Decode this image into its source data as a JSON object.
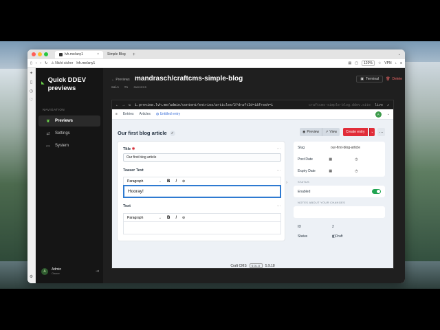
{
  "browser": {
    "tabs": [
      {
        "label": "lvh.me/any1",
        "active": true
      },
      {
        "label": "Simple Blog",
        "active": false
      }
    ],
    "url": {
      "security": "Nicht sicher",
      "address": "lvh.me/any1",
      "zoom": "120%",
      "vpn": "VPN"
    }
  },
  "ddev": {
    "app_name": "Quick DDEV previews",
    "nav_heading": "NAVIGATION",
    "nav": [
      {
        "label": "Previews",
        "icon": "leaf-icon",
        "active": true
      },
      {
        "label": "Settings",
        "icon": "sliders-icon",
        "active": false
      },
      {
        "label": "System",
        "icon": "server-icon",
        "active": false
      }
    ],
    "user": {
      "initial": "A",
      "name": "Admin",
      "role": "Owner"
    },
    "breadcrumb": "Previews",
    "project_title": "mandrasch/craftcms-simple-blog",
    "branch": "main",
    "pr": "#1",
    "status": "success",
    "terminal_label": "Terminal",
    "delete_label": "Delete"
  },
  "preview": {
    "url": "1.preview.lvh.me/admin/content/entries/articles/2?draftId=1&fresh=1",
    "host": "craftcms-simple-blog.ddev.site",
    "live": "live",
    "craft": {
      "crumbs": [
        "Entries",
        "Articles",
        "Untitled entry"
      ],
      "avatar": "A",
      "entry_title": "Our first blog article",
      "preview_label": "Preview",
      "view_label": "View",
      "create_label": "Create entry",
      "fields": {
        "title_label": "Title",
        "title_value": "Our first blog article",
        "teaser_label": "Teaser Text",
        "teaser_value": "Hooray!",
        "text_label": "Text",
        "paragraph": "Paragraph"
      },
      "meta": {
        "slug_label": "Slug",
        "slug_value": "our-first-blog-article",
        "post_date_label": "Post Date",
        "expiry_date_label": "Expiry Date",
        "status_heading": "STATUS",
        "enabled_label": "Enabled",
        "enabled": true,
        "notes_heading": "NOTES ABOUT YOUR CHANGES",
        "id_label": "ID",
        "id_value": "2",
        "status_label": "Status",
        "status_value": "Draft"
      },
      "footer": {
        "product": "Craft CMS",
        "edition": "SOLO",
        "version": "5.9.18"
      }
    }
  },
  "colors": {
    "accent_green": "#6bd34a",
    "create_red": "#e12d39",
    "focus_blue": "#2e7ad1",
    "toggle_green": "#20a452"
  }
}
